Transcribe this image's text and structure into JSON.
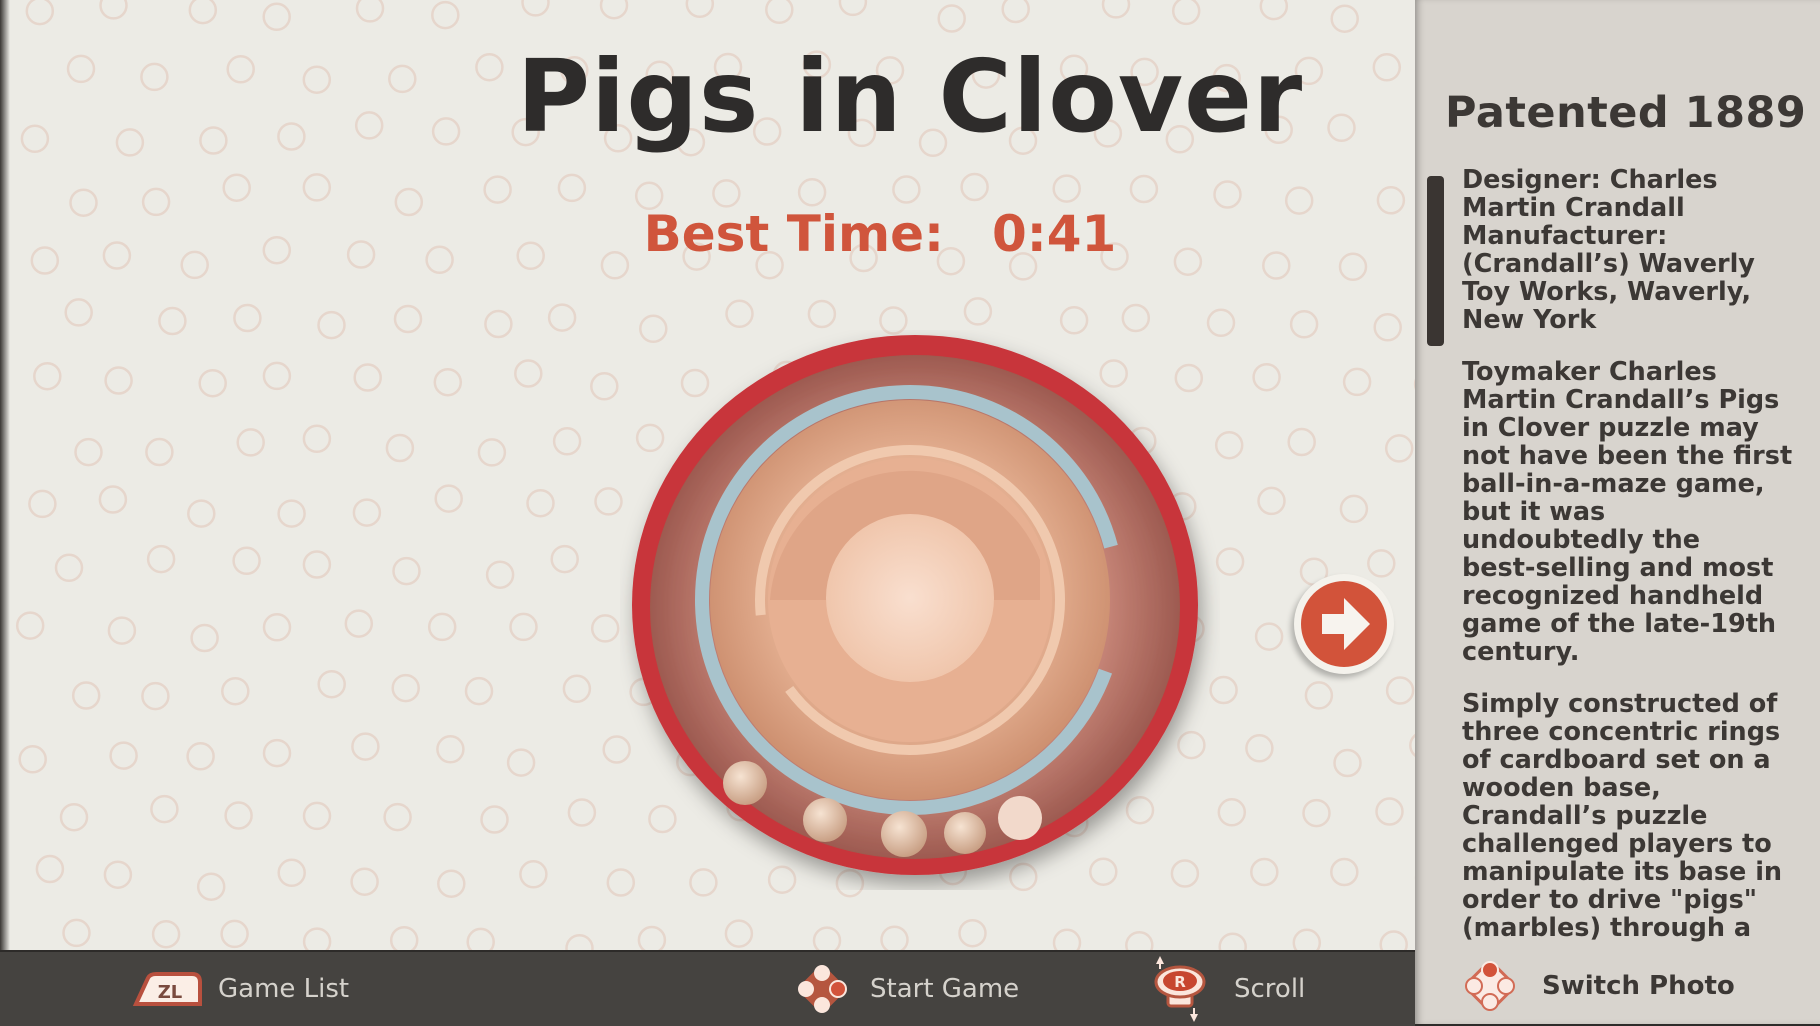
{
  "game": {
    "title": "Pigs in Clover",
    "best_time_label": "Best Time:",
    "best_time_value": "0:41",
    "image_alt": "Photo of the Pigs in Clover puzzle: red cardboard outer ring, blue middle ring and wooden center with five marbles",
    "next_photo_icon": "arrow-right-icon"
  },
  "side_panel": {
    "heading": "Patented 1889",
    "paragraphs": [
      "Designer: Charles\nMartin Crandall\nManufacturer:\n(Crandall’s) Waverly\nToy Works, Waverly,\nNew York",
      "Toymaker Charles\nMartin Crandall’s Pigs\nin Clover puzzle may\nnot have been the first\nball-in-a-maze game,\nbut it was\nundoubtedly the\nbest-selling and most\nrecognized handheld\ngame of the late-19th\ncentury.",
      "Simply constructed of\nthree concentric rings\nof cardboard set on a\nwooden base,\nCrandall’s puzzle\nchallenged players to\nmanipulate its base in\norder to drive \"pigs\"\n(marbles) through a"
    ],
    "switch_photo": {
      "label": "Switch Photo",
      "icon": "dpad-up-icon"
    }
  },
  "footer": {
    "game_list": {
      "label": "Game List",
      "button": "ZL",
      "icon": "zl-button-icon"
    },
    "start_game": {
      "label": "Start Game",
      "icon": "dpad-right-icon"
    },
    "scroll": {
      "label": "Scroll",
      "button": "R",
      "icon": "right-stick-icon"
    }
  },
  "colors": {
    "accent": "#d0553c",
    "background": "#ecebe5",
    "panel": "#d8d4ce",
    "footer": "#454340",
    "text_dark": "#2e2c2b"
  }
}
